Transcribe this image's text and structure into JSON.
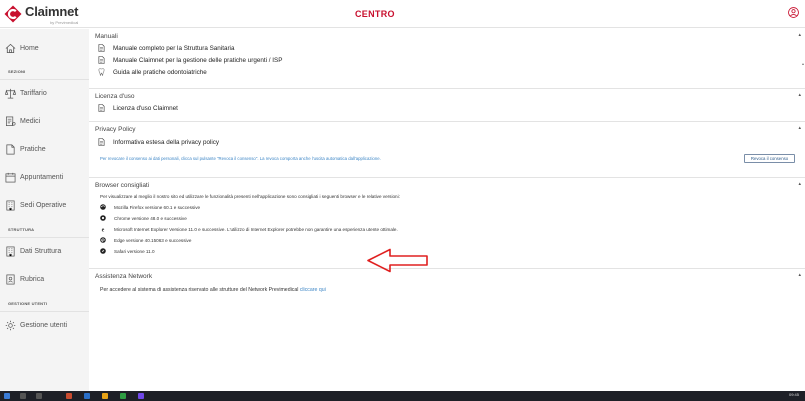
{
  "header": {
    "logo_name": "Claimnet",
    "logo_sub": "by Previmedical",
    "title": "CENTRO",
    "user_icon": "user-circle-icon",
    "brand_color": "#c8102e"
  },
  "sidebar": {
    "home": {
      "label": "Home",
      "icon": "home-icon"
    },
    "section_sezioni": "SEZIONI",
    "tariffario": {
      "label": "Tariffario",
      "icon": "balance-scale-icon"
    },
    "medici": {
      "label": "Medici",
      "icon": "doctor-icon"
    },
    "pratiche": {
      "label": "Pratiche",
      "icon": "document-icon"
    },
    "appuntamenti": {
      "label": "Appuntamenti",
      "icon": "calendar-icon"
    },
    "sedi": {
      "label": "Sedi Operative",
      "icon": "building-icon"
    },
    "section_struttura": "STRUTTURA",
    "dati": {
      "label": "Dati Struttura",
      "icon": "building-icon"
    },
    "rubrica": {
      "label": "Rubrica",
      "icon": "address-book-icon"
    },
    "section_gestione": "GESTIONE UTENTI",
    "gestione": {
      "label": "Gestione utenti",
      "icon": "gear-icon"
    }
  },
  "manuali": {
    "title": "Manuali",
    "items": [
      "Manuale completo per la Struttura Sanitaria",
      "Manuale Claimnet per la gestione delle pratiche urgenti / ISP",
      "Guida alle pratiche odontoiatriche"
    ]
  },
  "licenza": {
    "title": "Licenza d'uso",
    "item": "Licenza d'uso Claimnet"
  },
  "privacy": {
    "title": "Privacy Policy",
    "item": "Informativa estesa della privacy policy",
    "hint": "Per revocare il consenso ai dati personali, clicca sul pulsante \"Revoca il consenso\". La revoca comporta anche l'uscita automatica dall'applicazione.",
    "revoke_button": "Revoca il consenso"
  },
  "browser": {
    "title": "Browser consigliati",
    "intro": "Per visualizzare al meglio il nostro sito ed utilizzare le funzionalità presenti nell'applicazione sono consigliati i seguenti browser e le relative versioni:",
    "items": [
      {
        "text": "Mozilla Firefox versione 60.1 e successive",
        "icon": "firefox-icon"
      },
      {
        "text": "Chrome versione 48.0 e successive",
        "icon": "chrome-icon"
      },
      {
        "text": "Microsoft Internet Explorer Versione 11.0 e successive. L'utilizzo di Internet Explorer potrebbe non garantire una esperienza utente ottimale.",
        "icon": "internet-explorer-icon"
      },
      {
        "text": "Edge versione 40.15063 e successive",
        "icon": "edge-icon"
      },
      {
        "text": "Safari versione 11.0",
        "icon": "safari-icon"
      }
    ]
  },
  "network": {
    "title": "Assistenza Network",
    "text": "Per accedere al sistema di assistenza riservato alle strutture del Network Previmedical",
    "link": "cliccare qui"
  },
  "taskbar": {
    "time": "09:45"
  }
}
